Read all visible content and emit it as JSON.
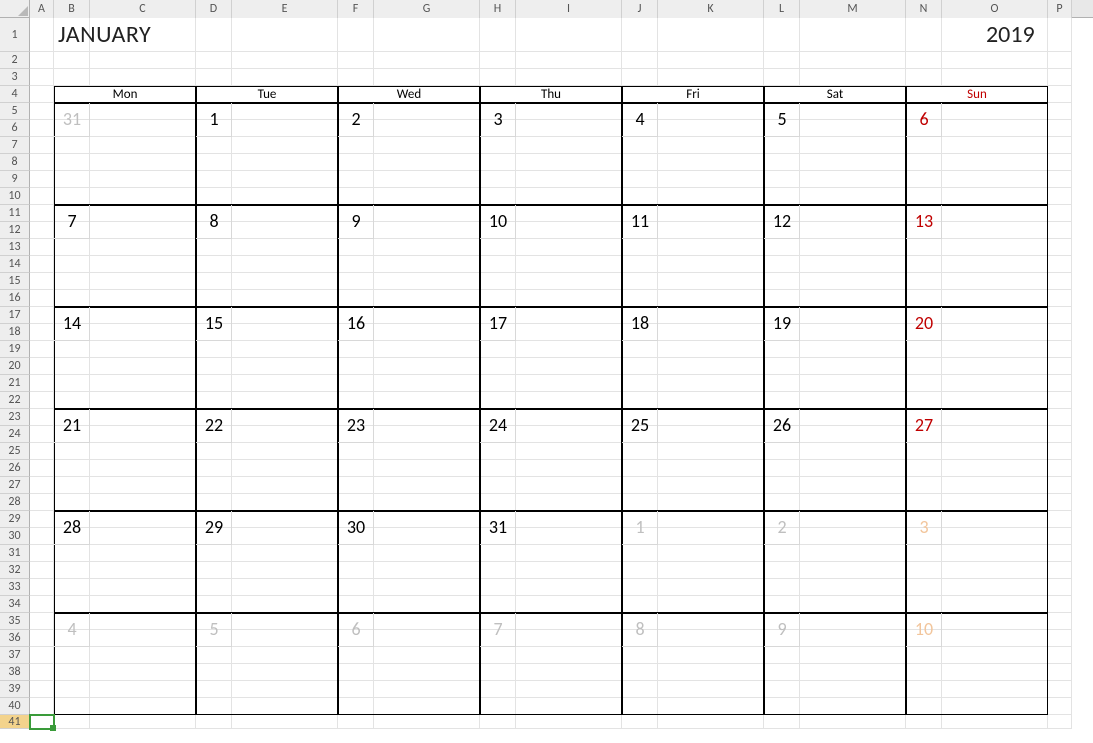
{
  "sheet": {
    "month_name": "JANUARY",
    "year": "2019",
    "column_labels": [
      "A",
      "B",
      "C",
      "D",
      "E",
      "F",
      "G",
      "H",
      "I",
      "J",
      "K",
      "L",
      "M",
      "N",
      "O",
      "P"
    ],
    "row_labels": [
      "1",
      "2",
      "3",
      "4",
      "5",
      "6",
      "7",
      "8",
      "9",
      "10",
      "11",
      "12",
      "13",
      "14",
      "15",
      "16",
      "17",
      "18",
      "19",
      "20",
      "21",
      "22",
      "23",
      "24",
      "25",
      "26",
      "27",
      "28",
      "29",
      "30",
      "31",
      "32",
      "33",
      "34",
      "35",
      "36",
      "37",
      "38",
      "39",
      "40",
      "41"
    ],
    "selected_row": "41"
  },
  "calendar": {
    "day_names": [
      "Mon",
      "Tue",
      "Wed",
      "Thu",
      "Fri",
      "Sat",
      "Sun"
    ],
    "weeks": [
      [
        {
          "n": "31",
          "dim": true,
          "sun": false
        },
        {
          "n": "1",
          "dim": false,
          "sun": false
        },
        {
          "n": "2",
          "dim": false,
          "sun": false
        },
        {
          "n": "3",
          "dim": false,
          "sun": false
        },
        {
          "n": "4",
          "dim": false,
          "sun": false
        },
        {
          "n": "5",
          "dim": false,
          "sun": false
        },
        {
          "n": "6",
          "dim": false,
          "sun": true
        }
      ],
      [
        {
          "n": "7",
          "dim": false,
          "sun": false
        },
        {
          "n": "8",
          "dim": false,
          "sun": false
        },
        {
          "n": "9",
          "dim": false,
          "sun": false
        },
        {
          "n": "10",
          "dim": false,
          "sun": false
        },
        {
          "n": "11",
          "dim": false,
          "sun": false
        },
        {
          "n": "12",
          "dim": false,
          "sun": false
        },
        {
          "n": "13",
          "dim": false,
          "sun": true
        }
      ],
      [
        {
          "n": "14",
          "dim": false,
          "sun": false
        },
        {
          "n": "15",
          "dim": false,
          "sun": false
        },
        {
          "n": "16",
          "dim": false,
          "sun": false
        },
        {
          "n": "17",
          "dim": false,
          "sun": false
        },
        {
          "n": "18",
          "dim": false,
          "sun": false
        },
        {
          "n": "19",
          "dim": false,
          "sun": false
        },
        {
          "n": "20",
          "dim": false,
          "sun": true
        }
      ],
      [
        {
          "n": "21",
          "dim": false,
          "sun": false
        },
        {
          "n": "22",
          "dim": false,
          "sun": false
        },
        {
          "n": "23",
          "dim": false,
          "sun": false
        },
        {
          "n": "24",
          "dim": false,
          "sun": false
        },
        {
          "n": "25",
          "dim": false,
          "sun": false
        },
        {
          "n": "26",
          "dim": false,
          "sun": false
        },
        {
          "n": "27",
          "dim": false,
          "sun": true
        }
      ],
      [
        {
          "n": "28",
          "dim": false,
          "sun": false
        },
        {
          "n": "29",
          "dim": false,
          "sun": false
        },
        {
          "n": "30",
          "dim": false,
          "sun": false
        },
        {
          "n": "31",
          "dim": false,
          "sun": false
        },
        {
          "n": "1",
          "dim": true,
          "sun": false
        },
        {
          "n": "2",
          "dim": true,
          "sun": false
        },
        {
          "n": "3",
          "dim": true,
          "sun": true
        }
      ],
      [
        {
          "n": "4",
          "dim": true,
          "sun": false
        },
        {
          "n": "5",
          "dim": true,
          "sun": false
        },
        {
          "n": "6",
          "dim": true,
          "sun": false
        },
        {
          "n": "7",
          "dim": true,
          "sun": false
        },
        {
          "n": "8",
          "dim": true,
          "sun": false
        },
        {
          "n": "9",
          "dim": true,
          "sun": false
        },
        {
          "n": "10",
          "dim": true,
          "sun": true
        }
      ]
    ]
  }
}
